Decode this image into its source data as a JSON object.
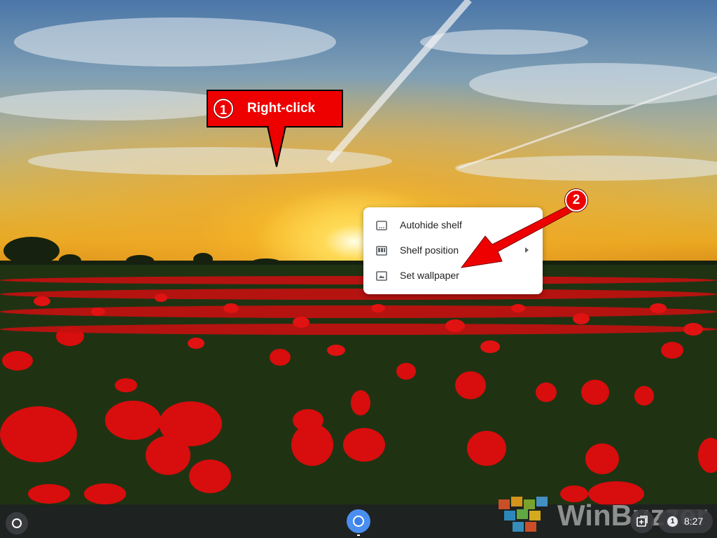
{
  "annotations": {
    "step1": {
      "number": "1",
      "text": "Right-click"
    },
    "step2": {
      "number": "2"
    }
  },
  "context_menu": {
    "items": [
      {
        "label": "Autohide shelf",
        "icon": "autohide-shelf-icon"
      },
      {
        "label": "Shelf position",
        "icon": "shelf-position-icon",
        "has_submenu": true
      },
      {
        "label": "Set wallpaper",
        "icon": "wallpaper-icon"
      }
    ]
  },
  "shelf": {
    "launcher_icon": "launcher-circle-icon",
    "pinned_apps": [
      {
        "name": "Chrome",
        "icon": "chrome-icon",
        "active": true
      }
    ]
  },
  "status_tray": {
    "notification_count": "1",
    "time": "8:27"
  },
  "watermark": {
    "text": "WinBuzzer"
  },
  "colors": {
    "annotation_red": "#ee0000",
    "menu_bg": "#ffffff",
    "shelf_bg": "#202124",
    "chrome_blue": "#4a8ef0"
  }
}
